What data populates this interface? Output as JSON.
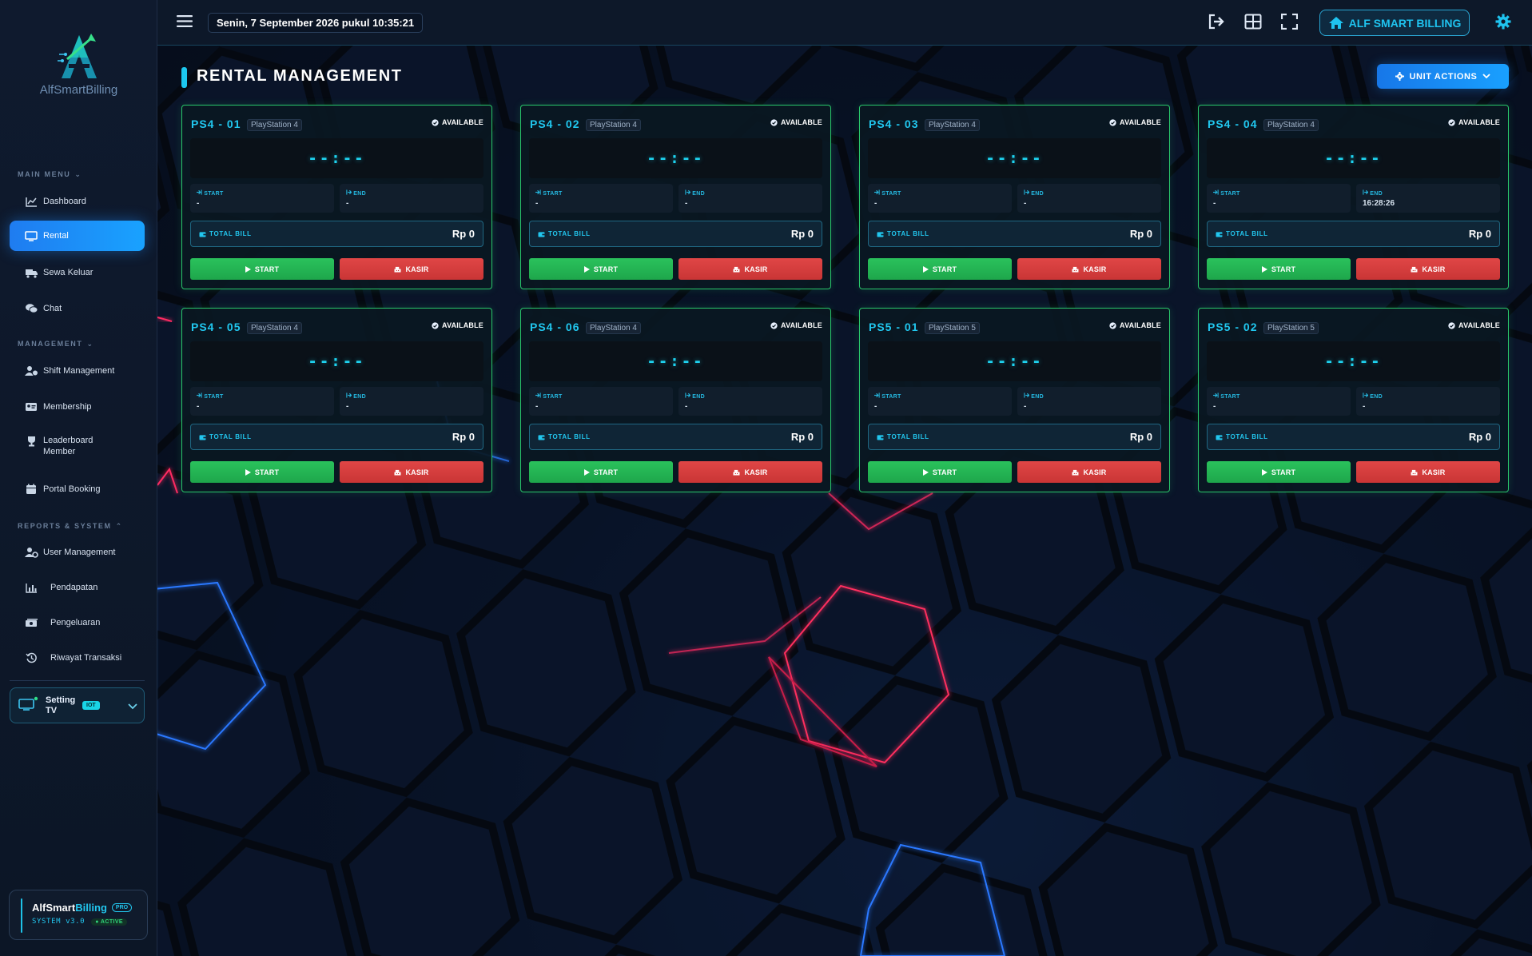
{
  "app": {
    "logo_text_main": "AlfSmart",
    "logo_text_accent": "Billing"
  },
  "sidebar": {
    "main_menu_title": "MAIN MENU",
    "management_title": "MANAGEMENT",
    "reports_title": "REPORTS & SYSTEM",
    "main_items": [
      {
        "label": "Dashboard",
        "icon": "chart-line-icon"
      },
      {
        "label": "Rental",
        "icon": "monitor-icon",
        "active": true
      },
      {
        "label": "Sewa Keluar",
        "icon": "truck-icon"
      },
      {
        "label": "Chat",
        "icon": "chat-icon"
      }
    ],
    "management_items": [
      {
        "label": "Shift Management",
        "icon": "user-clock-icon"
      },
      {
        "label": "Membership",
        "icon": "id-card-icon"
      },
      {
        "label": "Leaderboard Member",
        "icon": "trophy-icon"
      },
      {
        "label": "Portal Booking",
        "icon": "calendar-icon"
      }
    ],
    "report_items": [
      {
        "label": "User Management",
        "icon": "user-gear-icon"
      },
      {
        "label": "Pendapatan",
        "icon": "bar-chart-icon"
      },
      {
        "label": "Pengeluaran",
        "icon": "money-icon"
      },
      {
        "label": "Riwayat Transaksi",
        "icon": "history-icon"
      }
    ],
    "setting_tv": {
      "label": "Setting TV",
      "badge": "IOT"
    },
    "system_card": {
      "name_main": "AlfSmart",
      "name_accent": "Billing",
      "badge": "PRO",
      "version": "SYSTEM v3.0",
      "status": "● ACTIVE"
    }
  },
  "header": {
    "datetime": "Senin, 7 September 2026 pukul 10:35:21",
    "brand_button": "ALF SMART BILLING"
  },
  "page": {
    "title": "RENTAL MANAGEMENT",
    "unit_actions_label": "UNIT ACTIONS"
  },
  "labels": {
    "start": "START",
    "end": "END",
    "total_bill": "TOTAL BILL",
    "start_button": "START",
    "kasir_button": "KASIR"
  },
  "units": [
    {
      "name": "PS4 - 01",
      "type": "PlayStation 4",
      "status": "AVAILABLE",
      "timer": "--:--",
      "start": "-",
      "end": "-",
      "bill": "Rp 0"
    },
    {
      "name": "PS4 - 02",
      "type": "PlayStation 4",
      "status": "AVAILABLE",
      "timer": "--:--",
      "start": "-",
      "end": "-",
      "bill": "Rp 0"
    },
    {
      "name": "PS4 - 03",
      "type": "PlayStation 4",
      "status": "AVAILABLE",
      "timer": "--:--",
      "start": "-",
      "end": "-",
      "bill": "Rp 0"
    },
    {
      "name": "PS4 - 04",
      "type": "PlayStation 4",
      "status": "AVAILABLE",
      "timer": "--:--",
      "start": "-",
      "end": "16:28:26",
      "bill": "Rp 0"
    },
    {
      "name": "PS4 - 05",
      "type": "PlayStation 4",
      "status": "AVAILABLE",
      "timer": "--:--",
      "start": "-",
      "end": "-",
      "bill": "Rp 0"
    },
    {
      "name": "PS4 - 06",
      "type": "PlayStation 4",
      "status": "AVAILABLE",
      "timer": "--:--",
      "start": "-",
      "end": "-",
      "bill": "Rp 0"
    },
    {
      "name": "PS5 - 01",
      "type": "PlayStation 5",
      "status": "AVAILABLE",
      "timer": "--:--",
      "start": "-",
      "end": "-",
      "bill": "Rp 0"
    },
    {
      "name": "PS5 - 02",
      "type": "PlayStation 5",
      "status": "AVAILABLE",
      "timer": "--:--",
      "start": "-",
      "end": "-",
      "bill": "Rp 0"
    }
  ],
  "colors": {
    "accent_cyan": "#1fc3ef",
    "available_border": "#29c76b",
    "start_green": "#22b455",
    "kasir_red": "#d63c3c",
    "active_nav_blue": "#1a8cff"
  }
}
